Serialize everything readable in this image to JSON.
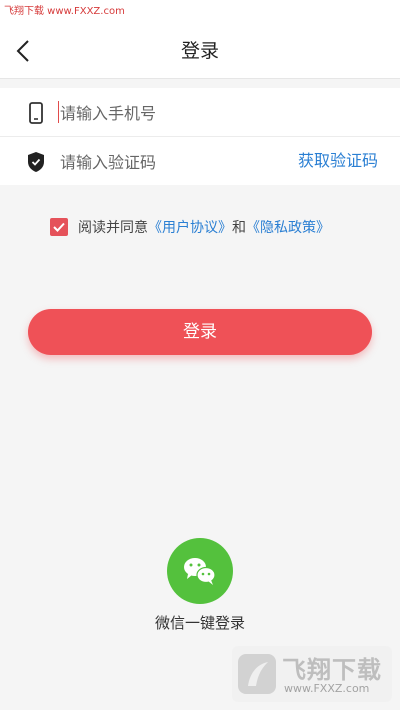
{
  "status_bar": {
    "text": "飞翔下载 www.FXXZ.com"
  },
  "header": {
    "title": "登录"
  },
  "form": {
    "phone_placeholder": "请输入手机号",
    "code_placeholder": "请输入验证码",
    "get_code_label": "获取验证码"
  },
  "agreement": {
    "checked": true,
    "prefix": "阅读并同意",
    "user_agreement": "《用户协议》",
    "and": "和",
    "privacy_policy": "《隐私政策》"
  },
  "login_button": {
    "label": "登录"
  },
  "wechat_login": {
    "label": "微信一键登录"
  },
  "watermark": {
    "name": "飞翔下载",
    "url": "www.FXXZ.com"
  },
  "colors": {
    "accent_red": "#ef5157",
    "link_blue": "#2a7fd3",
    "wechat_green": "#54c13d"
  }
}
